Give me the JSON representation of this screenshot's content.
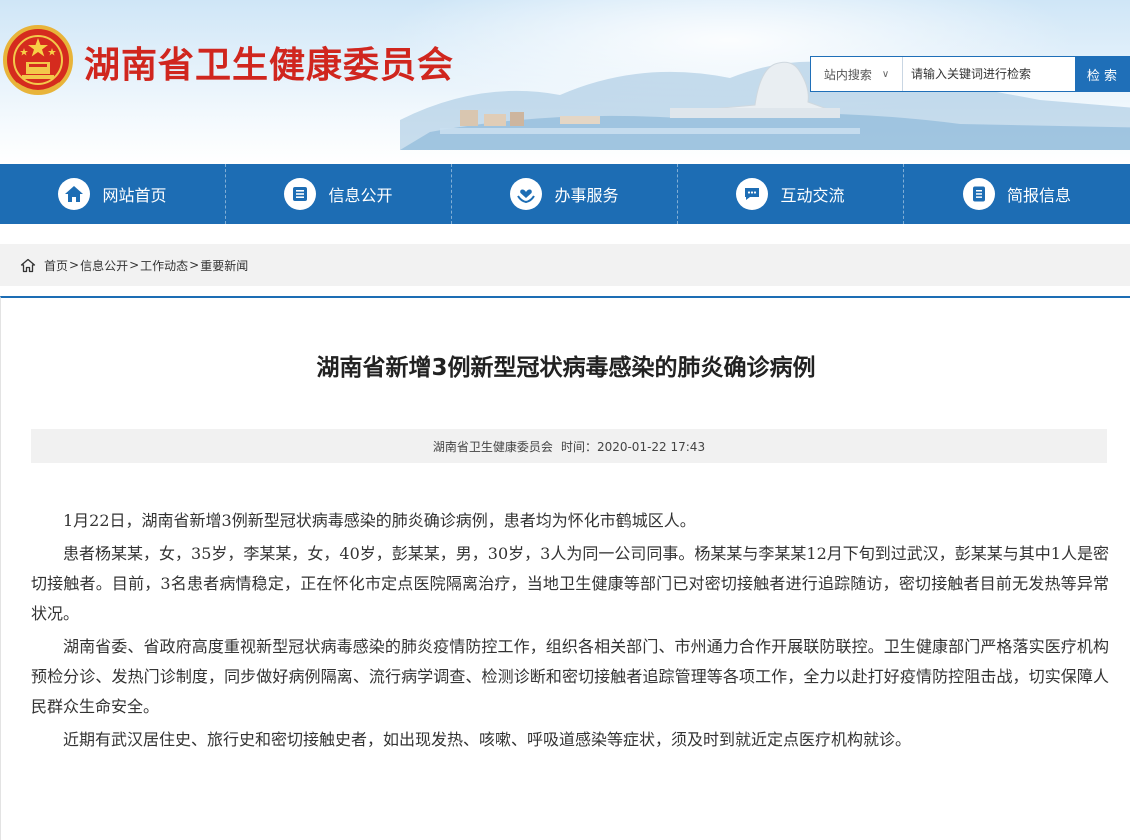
{
  "header": {
    "site_title": "湖南省卫生健康委员会",
    "emblem_icon": "national-emblem-icon",
    "search": {
      "scope_label": "站内搜索",
      "scope_caret": "∨",
      "placeholder": "请输入关键词进行检索",
      "button_label": "检 索"
    }
  },
  "nav": {
    "items": [
      {
        "label": "网站首页",
        "icon": "home-icon"
      },
      {
        "label": "信息公开",
        "icon": "list-icon"
      },
      {
        "label": "办事服务",
        "icon": "heart-hands-icon"
      },
      {
        "label": "互动交流",
        "icon": "chat-icon"
      },
      {
        "label": "简报信息",
        "icon": "document-icon"
      }
    ]
  },
  "breadcrumb": {
    "items": [
      "首页",
      "信息公开",
      "工作动态",
      "重要新闻"
    ],
    "separator": ">"
  },
  "article": {
    "title": "湖南省新增3例新型冠状病毒感染的肺炎确诊病例",
    "source": "湖南省卫生健康委员会",
    "time_label": "时间：2020-01-22 17:43",
    "paragraphs": [
      "1月22日，湖南省新增3例新型冠状病毒感染的肺炎确诊病例，患者均为怀化市鹤城区人。",
      "患者杨某某，女，35岁，李某某，女，40岁，彭某某，男，30岁，3人为同一公司同事。杨某某与李某某12月下旬到过武汉，彭某某与其中1人是密切接触者。目前，3名患者病情稳定，正在怀化市定点医院隔离治疗，当地卫生健康等部门已对密切接触者进行追踪随访，密切接触者目前无发热等异常状况。",
      "湖南省委、省政府高度重视新型冠状病毒感染的肺炎疫情防控工作，组织各相关部门、市州通力合作开展联防联控。卫生健康部门严格落实医疗机构预检分诊、发热门诊制度，同步做好病例隔离、流行病学调查、检测诊断和密切接触者追踪管理等各项工作，全力以赴打好疫情防控阻击战，切实保障人民群众生命安全。",
      "近期有武汉居住史、旅行史和密切接触史者，如出现发热、咳嗽、呼吸道感染等症状，须及时到就近定点医疗机构就诊。"
    ]
  },
  "colors": {
    "brand_red": "#d0261e",
    "nav_blue": "#1d6db4",
    "search_blue": "#1f6fb8"
  }
}
